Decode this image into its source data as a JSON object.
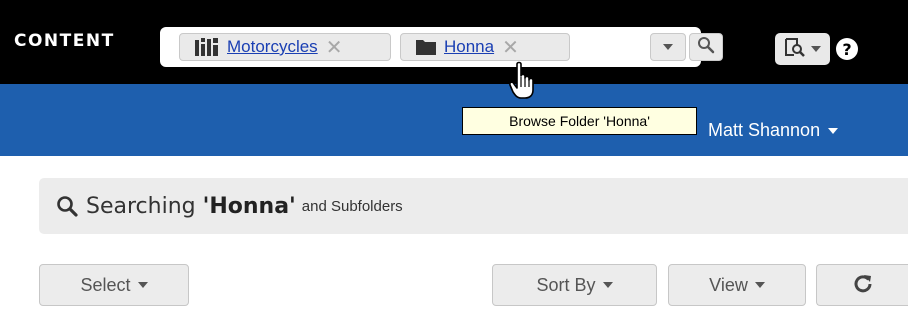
{
  "topbar": {
    "brand": "CONTENT",
    "chips": [
      {
        "label": "Motorcycles",
        "icon": "library-icon",
        "remove_glyph": "✕"
      },
      {
        "label": "Honna",
        "icon": "folder-icon",
        "remove_glyph": "✕"
      }
    ],
    "help_glyph": "?"
  },
  "bluebar": {
    "user_name": "Matt Shannon"
  },
  "tooltip": {
    "text": "Browse Folder 'Honna'"
  },
  "summary": {
    "prefix": "Searching ",
    "folder": "'Honna'",
    "suffix": "and Subfolders"
  },
  "toolbar": {
    "select_label": "Select",
    "sort_label": "Sort By",
    "view_label": "View"
  },
  "colors": {
    "topbar_bg": "#000000",
    "bluebar_bg": "#1e5fae",
    "link": "#1a3fb3",
    "tooltip_bg": "#ffffe1"
  }
}
